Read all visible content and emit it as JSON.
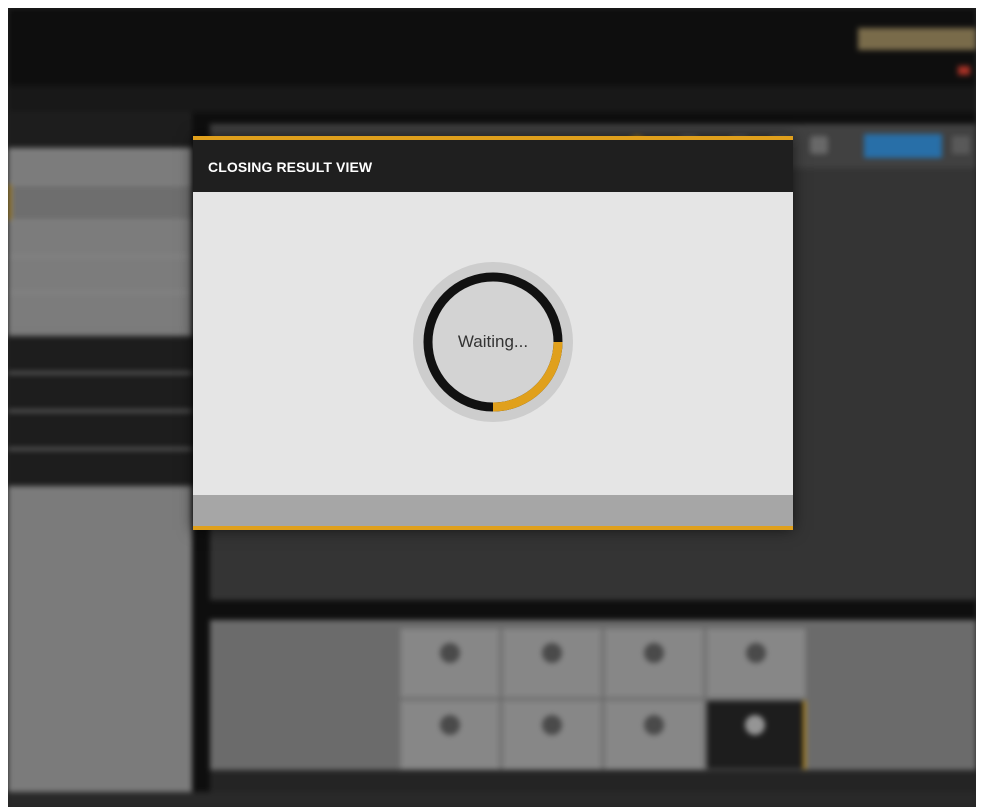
{
  "modal": {
    "title": "CLOSING RESULT VIEW",
    "status": "Waiting...",
    "progress": 0.25
  },
  "colors": {
    "accent": "#e0a01c",
    "ring": "#111111",
    "header": "#1f1f1f"
  }
}
